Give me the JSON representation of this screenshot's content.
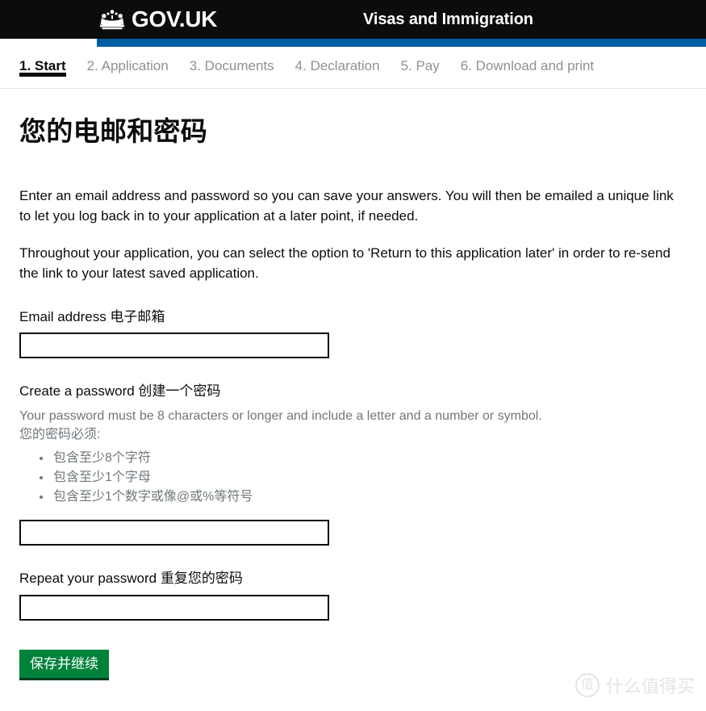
{
  "masthead": {
    "crown_icon": "crown-icon",
    "brand": "GOV.UK",
    "service_name": "Visas and Immigration",
    "bar_color": "#005ea5",
    "background": "#0b0c0c"
  },
  "step_nav": [
    {
      "label": "1. Start",
      "current": true
    },
    {
      "label": "2. Application",
      "current": false
    },
    {
      "label": "3. Documents",
      "current": false
    },
    {
      "label": "4. Declaration",
      "current": false
    },
    {
      "label": "5. Pay",
      "current": false
    },
    {
      "label": "6. Download and print",
      "current": false
    }
  ],
  "main": {
    "title": "您的电邮和密码",
    "paragraph_1": "Enter an email address and password so you can save your answers. You will then be emailed a unique link to let you log back in to your application at a later point, if needed.",
    "paragraph_2": "Throughout your application, you can select the option to 'Return to this application later' in order to re-send the link to your latest saved application.",
    "email": {
      "label": "Email address 电子邮箱",
      "value": "",
      "placeholder": ""
    },
    "password": {
      "label": "Create a password 创建一个密码",
      "hint_en": "Your password must be 8 characters or longer and include a letter and a number or symbol.",
      "hint_zh": "您的密码必须:",
      "requirements": [
        "包含至少8个字符",
        "包含至少1个字母",
        "包含至少1个数字或像@或%等符号"
      ],
      "value": "",
      "placeholder": ""
    },
    "repeat_password": {
      "label": "Repeat your password 重复您的密码",
      "value": "",
      "placeholder": ""
    },
    "submit_label": "保存并继续",
    "submit_color": "#00823b"
  },
  "watermark": {
    "badge": "值",
    "text": "什么值得买"
  }
}
